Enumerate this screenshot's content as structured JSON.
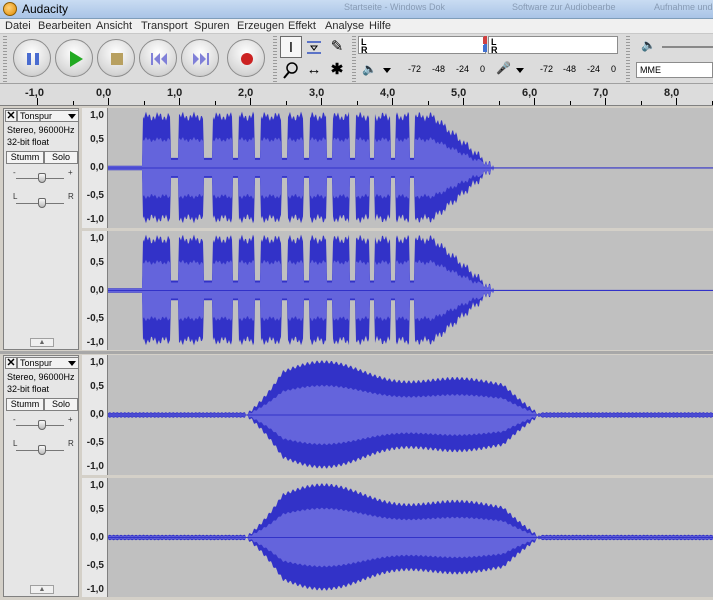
{
  "window": {
    "title": "Audacity",
    "background_tabs": [
      "Startseite - Windows Dokumentenansicht",
      "Software zur Audiobearbeitung - Micr...",
      "Aufnahme und Bearbeitung - Neu..."
    ]
  },
  "menu": {
    "items": [
      "Datei",
      "Bearbeiten",
      "Ansicht",
      "Transport",
      "Spuren",
      "Erzeugen",
      "Effekt",
      "Analyse",
      "Hilfe"
    ]
  },
  "toolbar": {
    "transport": [
      "pause-icon",
      "play-icon",
      "stop-icon",
      "skip-start-icon",
      "skip-end-icon",
      "record-icon"
    ],
    "tools": [
      "selection-tool-icon",
      "envelope-tool-icon",
      "draw-tool-icon",
      "zoom-tool-icon",
      "timeshift-tool-icon",
      "multi-tool-icon"
    ],
    "meter_left": "L",
    "meter_right": "R",
    "meter_scale": [
      "-72",
      "-48",
      "-24",
      "0",
      "-72",
      "-48",
      "-24",
      "0"
    ],
    "host": "MME",
    "colors": {
      "meter_mark_red": "#d04040",
      "meter_mark_blue": "#4070d0",
      "record_red": "#cc2222",
      "play_green": "#22aa22",
      "stop_tan": "#b8a060",
      "skip_purple": "#8080d8",
      "pause_blue": "#4a6cd0"
    }
  },
  "ruler": {
    "labels": [
      "-1,0",
      "0,0",
      "1,0",
      "2,0",
      "3,0",
      "4,0",
      "5,0",
      "6,0",
      "7,0",
      "8,0"
    ]
  },
  "tracks": [
    {
      "name": "Tonspur",
      "info_line1": "Stereo, 96000Hz",
      "info_line2": "32-bit float",
      "mute": "Stumm",
      "solo": "Solo",
      "gain_minus": "-",
      "gain_plus": "+",
      "pan_left": "L",
      "pan_right": "R",
      "channel_scale": [
        "1,0",
        "0,5",
        "0,0",
        "-0,5",
        "-1,0"
      ],
      "wave_color": "#3232c8",
      "wave_rms_color": "#6464dc"
    },
    {
      "name": "Tonspur",
      "info_line1": "Stereo, 96000Hz",
      "info_line2": "32-bit float",
      "mute": "Stumm",
      "solo": "Solo",
      "gain_minus": "-",
      "gain_plus": "+",
      "pan_left": "L",
      "pan_right": "R",
      "channel_scale": [
        "1,0",
        "0,5",
        "0,0",
        "-0,5",
        "-1,0"
      ],
      "wave_color": "#3232c8",
      "wave_rms_color": "#6464dc"
    }
  ]
}
